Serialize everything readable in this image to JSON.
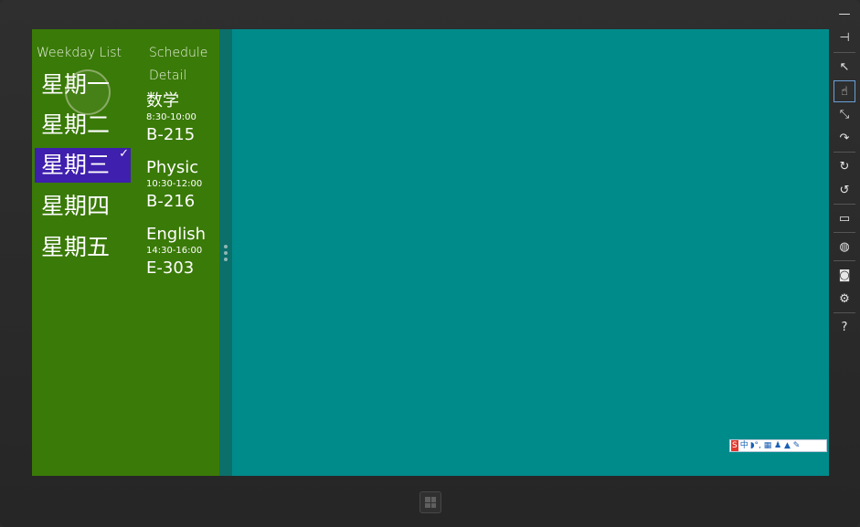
{
  "app": {
    "headers": {
      "weekday_list": "Weekday List",
      "schedule": "Schedule",
      "detail": "Detail"
    },
    "weekdays": [
      "星期一",
      "星期二",
      "星期三",
      "星期四",
      "星期五"
    ],
    "selected_index": 2,
    "courses": [
      {
        "name": "数学",
        "time": "8:30-10:00",
        "room": "B-215"
      },
      {
        "name": "Physic",
        "time": "10:30-12:00",
        "room": "B-216"
      },
      {
        "name": "English",
        "time": "14:30-16:00",
        "room": "E-303"
      }
    ]
  },
  "colors": {
    "snapped_bg": "#3a7a08",
    "main_bg": "#008b8b",
    "selection": "#3f1fad"
  },
  "simulator_toolbar": [
    {
      "icon": "minimize-icon",
      "glyph": "—"
    },
    {
      "icon": "pin-icon",
      "glyph": "⊣"
    },
    {
      "icon": "mouse-mode-icon",
      "glyph": "↖"
    },
    {
      "icon": "touch-mode-icon",
      "glyph": "☝"
    },
    {
      "icon": "pinch-zoom-icon",
      "glyph": "⤡"
    },
    {
      "icon": "rotation-touch-icon",
      "glyph": "↷"
    },
    {
      "icon": "rotate-clockwise-icon",
      "glyph": "↻"
    },
    {
      "icon": "rotate-counterclockwise-icon",
      "glyph": "↺"
    },
    {
      "icon": "change-resolution-icon",
      "glyph": "▭"
    },
    {
      "icon": "set-location-icon",
      "glyph": "◍"
    },
    {
      "icon": "screenshot-icon",
      "glyph": "◙"
    },
    {
      "icon": "settings-icon",
      "glyph": "⚙"
    },
    {
      "icon": "help-icon",
      "glyph": "?"
    }
  ],
  "ime_bar": {
    "logo": "S",
    "mode": "中",
    "items": "◗°, ▦ ♟ ▲ ✎"
  }
}
